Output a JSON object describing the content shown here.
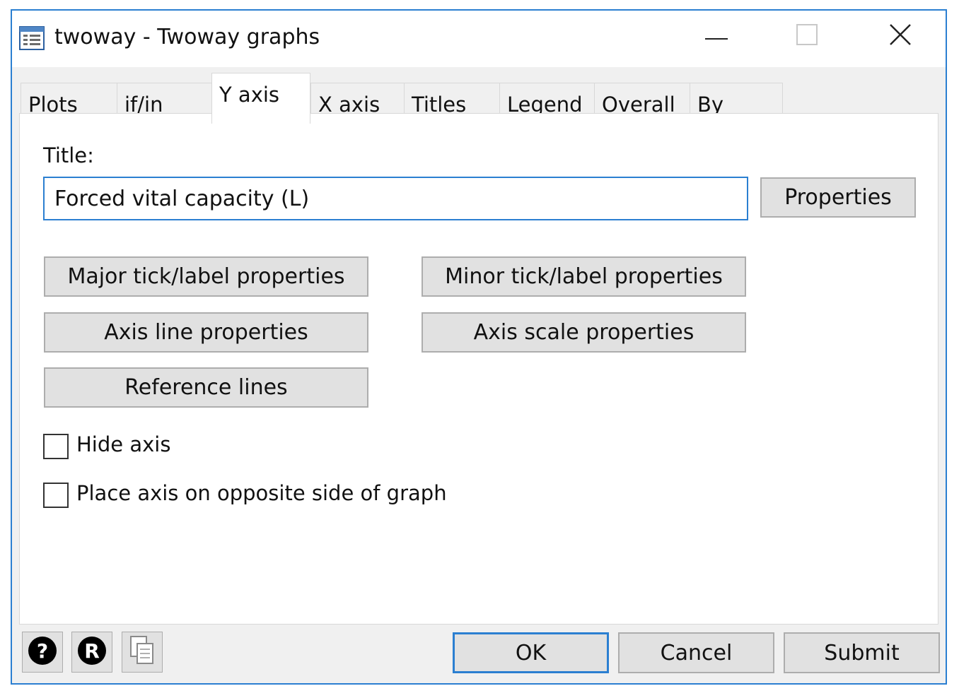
{
  "window": {
    "title": "twoway - Twoway graphs"
  },
  "tabs": [
    {
      "label": "Plots"
    },
    {
      "label": "if/in"
    },
    {
      "label": "Y axis",
      "active": true
    },
    {
      "label": "X axis"
    },
    {
      "label": "Titles"
    },
    {
      "label": "Legend"
    },
    {
      "label": "Overall"
    },
    {
      "label": "By"
    }
  ],
  "yaxis": {
    "title_label": "Title:",
    "title_value": "Forced vital capacity (L)",
    "properties_button": "Properties",
    "major_tick_button": "Major tick/label properties",
    "minor_tick_button": "Minor tick/label properties",
    "axis_line_button": "Axis line properties",
    "axis_scale_button": "Axis scale properties",
    "reference_lines_button": "Reference lines",
    "hide_axis_label": "Hide axis",
    "hide_axis_checked": false,
    "opposite_side_label": "Place axis on opposite side of graph",
    "opposite_side_checked": false
  },
  "footer": {
    "help_icon": "help-icon",
    "reset_icon": "reset-icon",
    "copy_icon": "copy-command-icon",
    "ok_label": "OK",
    "cancel_label": "Cancel",
    "submit_label": "Submit"
  },
  "colors": {
    "accent": "#2b7fd1",
    "button_face": "#e1e1e1",
    "dialog_bg": "#f0f0f0"
  }
}
